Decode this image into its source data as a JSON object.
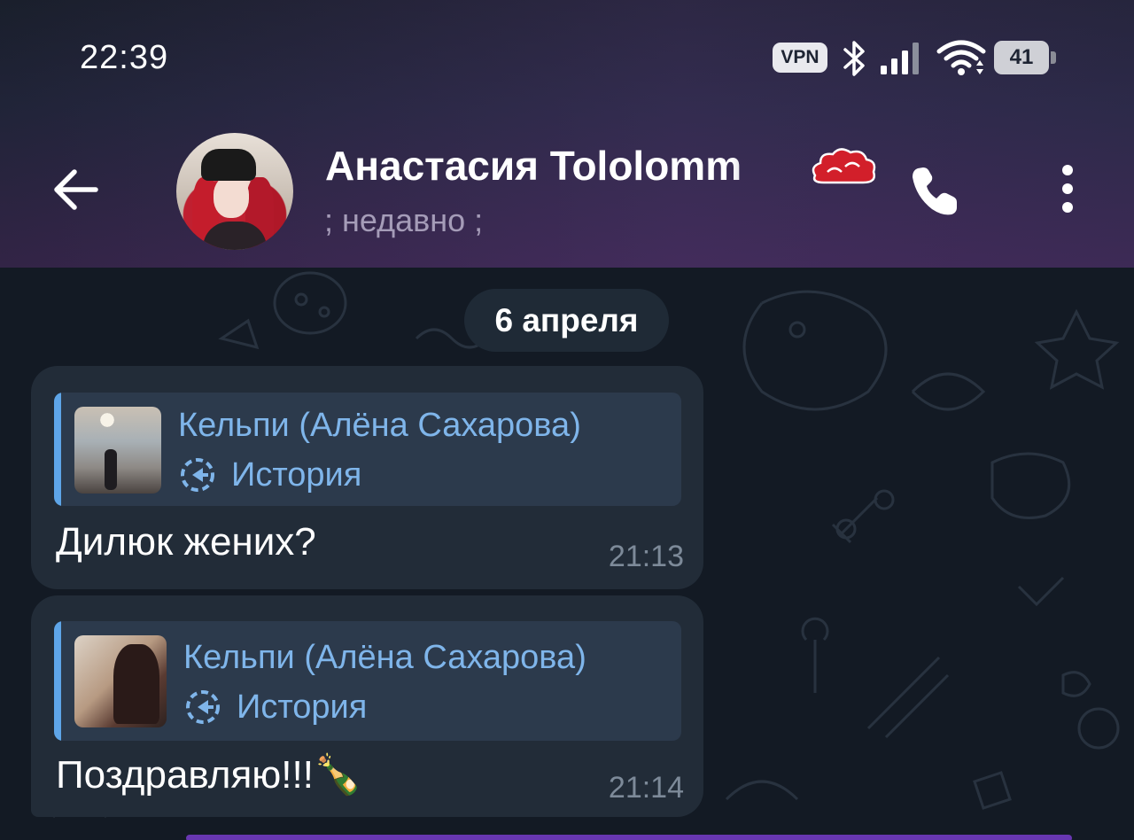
{
  "status_bar": {
    "time": "22:39",
    "vpn_label": "VPN",
    "battery_level": "41",
    "icons": [
      "bluetooth-icon",
      "signal-icon",
      "wifi-icon",
      "battery-icon"
    ]
  },
  "header": {
    "contact_name": "Анастасия Tololomm",
    "name_emoji": "red-cloud-icon",
    "last_seen": "; недавно ;"
  },
  "chat": {
    "date_separator": "6 апреля",
    "messages": [
      {
        "reply_author": "Кельпи (Алёна Сахарова)",
        "reply_type": "История",
        "text": "Дилюк жених?",
        "time": "21:13"
      },
      {
        "reply_author": "Кельпи (Алёна Сахарова)",
        "reply_type": "История",
        "text": "Поздравляю!!!🍾",
        "time": "21:14"
      }
    ]
  },
  "colors": {
    "accent": "#7fb5ea",
    "bubble": "#222c38",
    "reply_bg": "#2c3a4c",
    "header_gradient_end": "#3b2a52"
  }
}
